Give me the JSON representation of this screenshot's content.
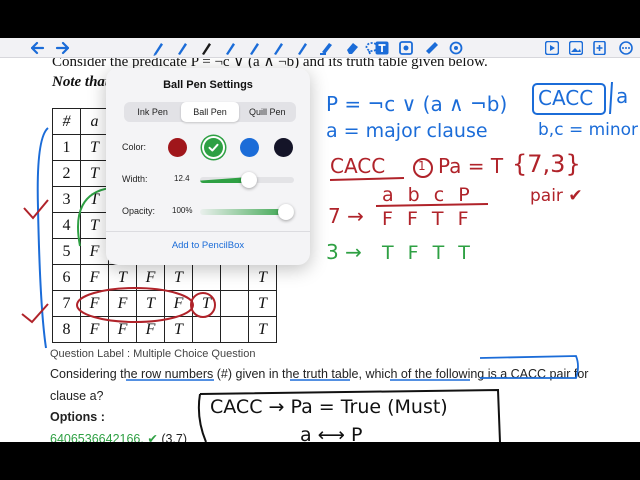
{
  "toolbar": {
    "icons": [
      "back-icon",
      "forward-icon",
      "pencil-icon",
      "pen-icon",
      "ball-pen-icon",
      "fountain-pen-icon",
      "pen-2-icon",
      "pen-3-icon",
      "pen-4-icon",
      "highlighter-icon",
      "eraser-icon",
      "lasso-icon",
      "text-icon",
      "shape-icon",
      "ruler-icon",
      "color-picker-icon",
      "play-icon",
      "image-icon",
      "add-page-icon",
      "more-icon"
    ],
    "colors": {
      "blue": "#1b6cd8",
      "black": "#1a1a1a"
    }
  },
  "document": {
    "heading_line1": "Consider the predicate P = ¬c ∨ (a ∧ ¬b) and its truth table given below.",
    "heading_line2": "Note that the value F in the truth table.",
    "table": {
      "headers": [
        "#",
        "a",
        "",
        "",
        "",
        "",
        "",
        ""
      ],
      "rows": [
        [
          "1",
          "T",
          "",
          "",
          "",
          "",
          "",
          ""
        ],
        [
          "2",
          "T",
          "",
          "",
          "",
          "",
          "",
          ""
        ],
        [
          "3",
          "T",
          "",
          "",
          "",
          "",
          "",
          ""
        ],
        [
          "4",
          "T",
          "",
          "",
          "",
          "",
          "",
          ""
        ],
        [
          "5",
          "F",
          "",
          "",
          "",
          "",
          "",
          ""
        ],
        [
          "6",
          "F",
          "T",
          "F",
          "T",
          "",
          "",
          "T"
        ],
        [
          "7",
          "F",
          "F",
          "T",
          "F",
          "T",
          "",
          "T"
        ],
        [
          "8",
          "F",
          "F",
          "F",
          "T",
          "",
          "",
          "T"
        ]
      ]
    },
    "question_label": "Question Label : Multiple Choice Question",
    "question_line1": "Considering the row numbers (#) given in the truth table, which of the following is a CACC pair for",
    "question_line2": "clause a?",
    "options_label": "Options :",
    "option_id": "6406536642166.",
    "option_check": "✔",
    "option_value": "(3,7)"
  },
  "ink": {
    "p_def": "P = ¬c ∨ (a ∧ ¬b)",
    "a_major": "a = major clause",
    "cacc_box": "CACC",
    "a_box": "a",
    "bc_minor": "b,c = minor",
    "cacc_title": "CACC",
    "circle_1": "1",
    "pa_eq": "Pa = T",
    "pair_set": "{7,3}",
    "pair_label": "pair ✔",
    "cols_header": "a b c P",
    "row7_label": "7 →",
    "row7_values": "F F T F",
    "row3_label": "3 →",
    "row3_values": "T F T T",
    "bottom_box": "CACC → Pa = True (Must)",
    "bottom_arrow": "a ⟷ P",
    "colors": {
      "blue": "#1b6cd8",
      "red": "#b0232a",
      "green": "#2ea043",
      "black": "#111111"
    }
  },
  "popover": {
    "title": "Ball Pen Settings",
    "tabs": [
      "Ink Pen",
      "Ball Pen",
      "Quill Pen"
    ],
    "selected_tab": "Ball Pen",
    "color_label": "Color:",
    "swatches": [
      "#a0161b",
      "#2ea043",
      "#1b6cd8",
      "#141428"
    ],
    "selected_swatch": "#2ea043",
    "width_label": "Width:",
    "width_value": "12.4",
    "width_fraction": 0.52,
    "opacity_label": "Opacity:",
    "opacity_value": "100%",
    "opacity_fraction": 1.0,
    "add_link": "Add to PencilBox"
  }
}
